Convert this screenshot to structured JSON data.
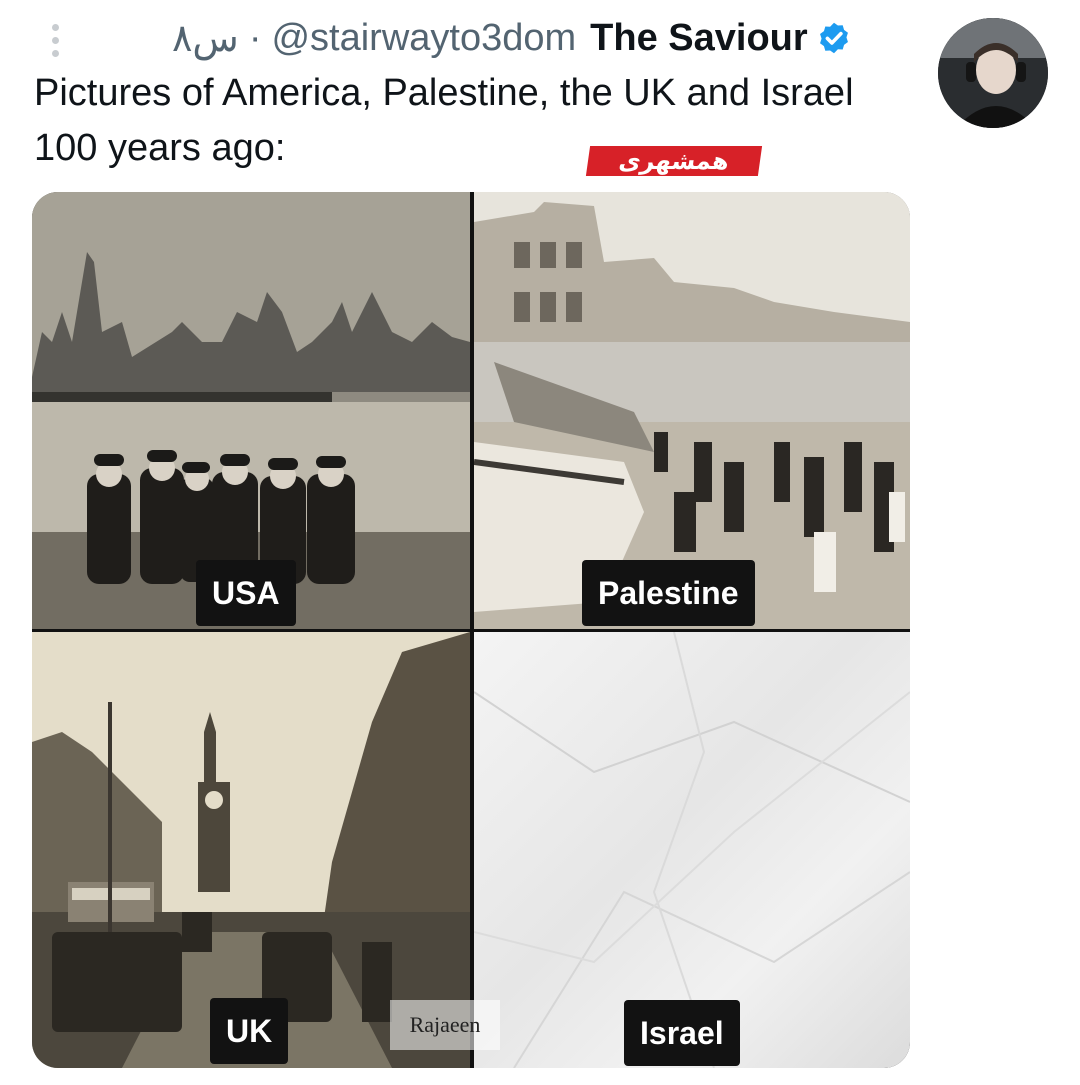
{
  "tweet": {
    "time": "۸س",
    "separator": "·",
    "handle": "@stairwayto3dom",
    "display_name": "The Saviour",
    "text": "Pictures of America, Palestine, the UK and Israel 100 years ago:",
    "watermark": "همشهری"
  },
  "media": {
    "labels": [
      "USA",
      "Palestine",
      "UK",
      "Israel"
    ],
    "signature": "Rajaeen"
  },
  "colors": {
    "verified": "#1d9bf0",
    "watermark_bg": "#d72128",
    "label_bg": "#121212"
  },
  "icons": [
    "more-vertical-icon",
    "verified-badge-icon"
  ]
}
